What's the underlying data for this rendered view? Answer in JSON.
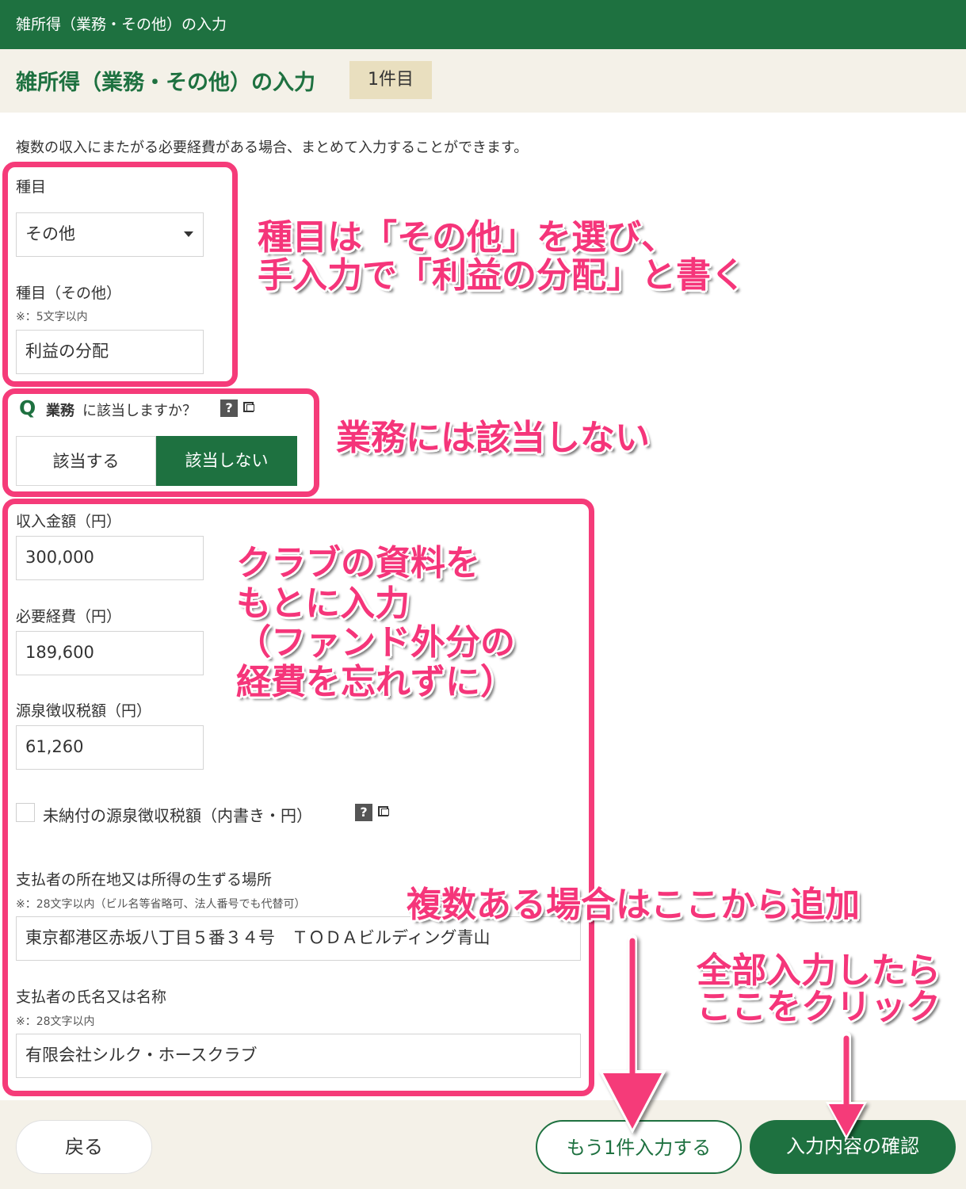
{
  "app": {
    "topbar_title": "雑所得（業務・その他）の入力",
    "page_title": "雑所得（業務・その他）の入力",
    "count_badge": "1件目"
  },
  "form": {
    "intro": "複数の収入にまたがる必要経費がある場合、まとめて入力することができます。",
    "category": {
      "label": "種目",
      "value": "その他"
    },
    "category_other": {
      "label": "種目（その他）",
      "note": "※：5文字以内",
      "value": "利益の分配"
    },
    "business_question": {
      "q_mark": "Q",
      "keyword": "業務",
      "text": "に該当しますか？",
      "help": "?",
      "options": [
        "該当する",
        "該当しない"
      ],
      "selected": "該当しない"
    },
    "income": {
      "label": "収入金額（円）",
      "value": "300,000"
    },
    "expenses": {
      "label": "必要経費（円）",
      "value": "189,600"
    },
    "withholding": {
      "label": "源泉徴収税額（円）",
      "value": "61,260"
    },
    "unpaid_withholding": {
      "label": "未納付の源泉徴収税額（内書き・円）",
      "help": "?",
      "checked": false
    },
    "payer_address": {
      "label": "支払者の所在地又は所得の生ずる場所",
      "note": "※：28文字以内（ビル名等省略可、法人番号でも代替可）",
      "value": "東京都港区赤坂八丁目５番３４号　ＴＯＤＡビルディング青山"
    },
    "payer_name": {
      "label": "支払者の氏名又は名称",
      "note": "※：28文字以内",
      "value": "有限会社シルク・ホースクラブ"
    }
  },
  "footer": {
    "back": "戻る",
    "add_another": "もう1件入力する",
    "confirm": "入力内容の確認"
  },
  "annotations": {
    "category_line1": "種目は「その他」を選び、",
    "category_line2": "手入力で「利益の分配」と書く",
    "business": "業務には該当しない",
    "club_line1": "クラブの資料を",
    "club_line2": "もとに入力",
    "club_line3": "（ファンド外分の",
    "club_line4": "経費を忘れずに）",
    "multiple": "複数ある場合はここから追加",
    "confirm_line1": "全部入力したら",
    "confirm_line2": "ここをクリック"
  },
  "colors": {
    "brand_green": "#1e7140",
    "header_beige": "#f4f1e8",
    "badge_beige": "#e9dfbf",
    "annotation_pink": "#f53b79"
  }
}
